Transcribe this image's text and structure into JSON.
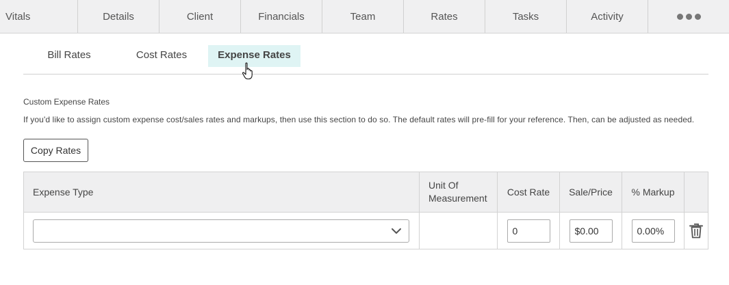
{
  "nav": {
    "items": [
      {
        "label": "Vitals"
      },
      {
        "label": "Details"
      },
      {
        "label": "Client"
      },
      {
        "label": "Financials"
      },
      {
        "label": "Team"
      },
      {
        "label": "Rates"
      },
      {
        "label": "Tasks"
      },
      {
        "label": "Activity"
      }
    ],
    "more_icon": "more-horizontal-icon"
  },
  "subtabs": {
    "bill_rates": "Bill Rates",
    "cost_rates": "Cost Rates",
    "expense_rates": "Expense Rates",
    "active": "Expense Rates",
    "active_bg": "#dff4f4"
  },
  "section": {
    "title": "Custom Expense Rates",
    "description": "If you'd like to assign custom expense cost/sales rates and markups, then use this section to do so. The default rates will pre-fill for your reference. Then, can be adjusted as needed.",
    "copy_button": "Copy Rates"
  },
  "table": {
    "headers": {
      "expense_type": "Expense Type",
      "unit_line1": "Unit Of",
      "unit_line2": "Measurement",
      "cost_rate": "Cost Rate",
      "sale_price": "Sale/Price",
      "markup": "% Markup"
    },
    "rows": [
      {
        "expense_type": "",
        "unit": "",
        "cost_rate": "0",
        "sale_price": "$0.00",
        "markup": "0.00%",
        "delete_icon": "trash-icon"
      }
    ]
  }
}
